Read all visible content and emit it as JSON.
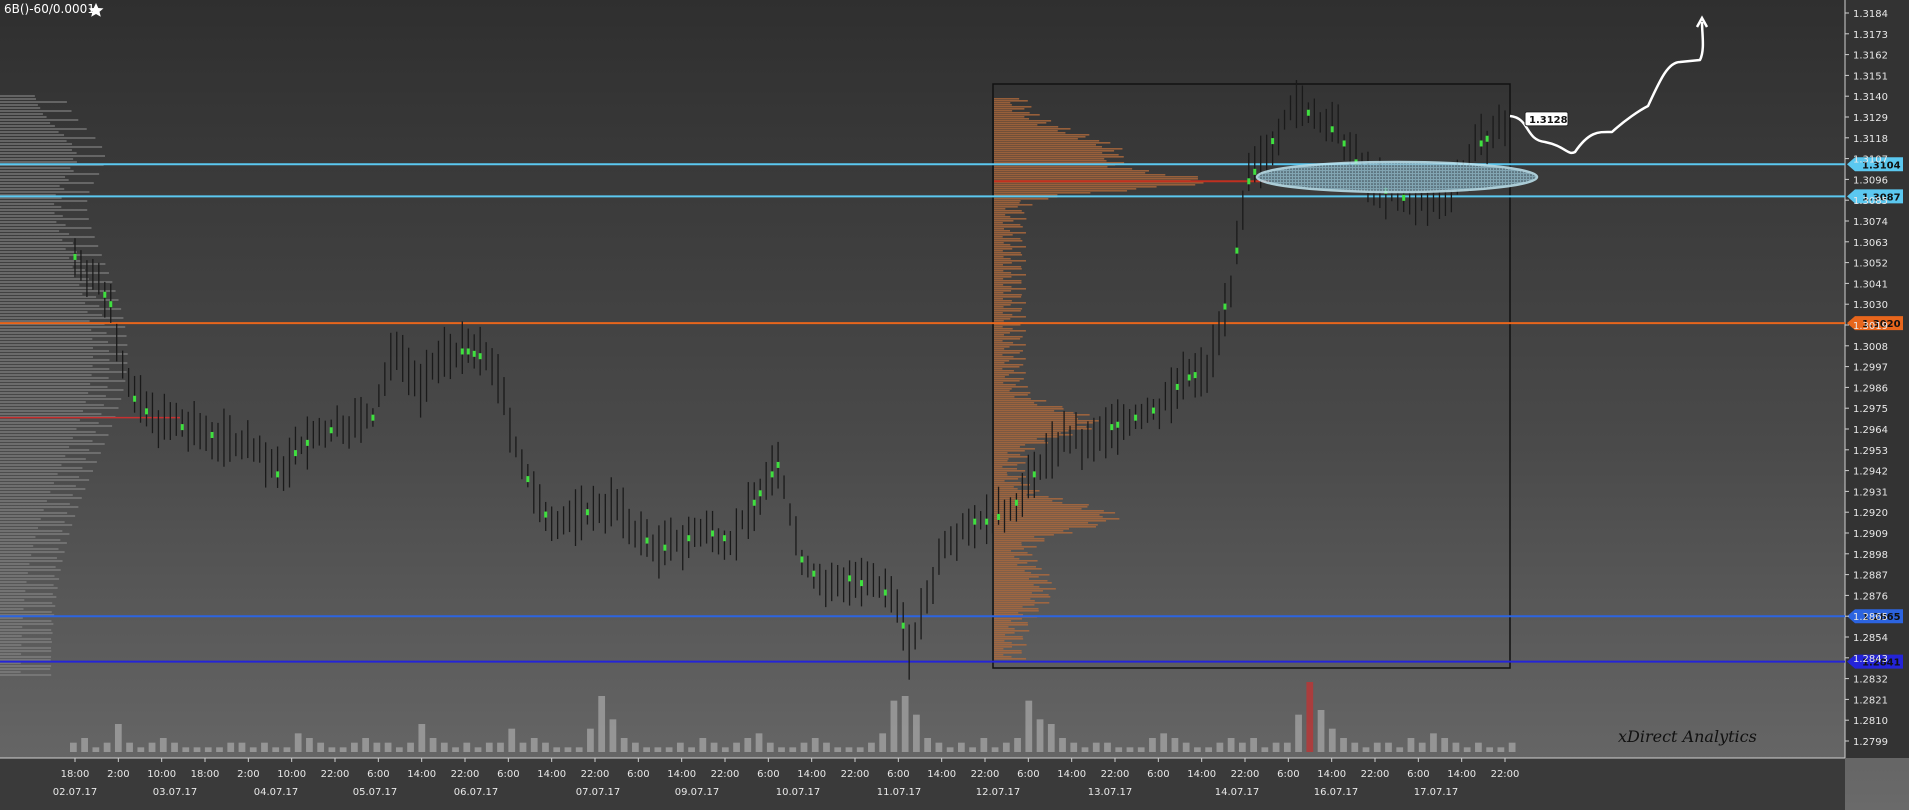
{
  "chart_data": {
    "type": "candlestick",
    "title": "6B()-60/0.0001",
    "watermark": "xDirect Analytics",
    "y_range": [
      1.279,
      1.319
    ],
    "y_ticks": [
      "1.3184",
      "1.3173",
      "1.3162",
      "1.3151",
      "1.3140",
      "1.3129",
      "1.3118",
      "1.3107",
      "1.3096",
      "1.3085",
      "1.3074",
      "1.3063",
      "1.3052",
      "1.3041",
      "1.3030",
      "1.3019",
      "1.3008",
      "1.2997",
      "1.2986",
      "1.2975",
      "1.2964",
      "1.2953",
      "1.2942",
      "1.2931",
      "1.2920",
      "1.2909",
      "1.2898",
      "1.2887",
      "1.2876",
      "1.2865",
      "1.2854",
      "1.2843",
      "1.2832",
      "1.2821",
      "1.2810",
      "1.2799"
    ],
    "x_time_labels": [
      "18:00",
      "2:00",
      "10:00",
      "18:00",
      "2:00",
      "10:00",
      "22:00",
      "6:00",
      "14:00",
      "22:00",
      "6:00",
      "14:00",
      "22:00",
      "6:00",
      "14:00",
      "22:00",
      "6:00",
      "14:00",
      "22:00",
      "6:00",
      "14:00",
      "22:00",
      "6:00",
      "14:00",
      "22:00",
      "6:00",
      "14:00",
      "22:00",
      "6:00",
      "14:00",
      "22:00",
      "6:00",
      "14:00",
      "22:00"
    ],
    "x_date_labels": [
      "02.07.17",
      "03.07.17",
      "04.07.17",
      "05.07.17",
      "06.07.17",
      "07.07.17",
      "09.07.17",
      "10.07.17",
      "11.07.17",
      "12.07.17",
      "13.07.17",
      "14.07.17",
      "16.07.17",
      "17.07.17"
    ],
    "levels": [
      {
        "price": 1.3104,
        "label": "1.3104",
        "color": "#5bc8f0"
      },
      {
        "price": 1.3087,
        "label": "1.3087",
        "color": "#5bc8f0"
      },
      {
        "price": 1.302,
        "label": "1.3020",
        "color": "#e8661c"
      },
      {
        "price": 1.2865,
        "label": "1.2865",
        "color": "#2c64e0"
      },
      {
        "price": 1.2841,
        "label": "1.2841",
        "color": "#2424d8"
      }
    ],
    "price_callout": {
      "price": 1.3128,
      "label": "1.3128"
    },
    "price_path": [
      [
        0,
        1.3055
      ],
      [
        3,
        1.3045
      ],
      [
        6,
        1.303
      ],
      [
        8,
        1.3
      ],
      [
        10,
        1.298
      ],
      [
        13,
        1.297
      ],
      [
        18,
        1.2965
      ],
      [
        24,
        1.296
      ],
      [
        30,
        1.2955
      ],
      [
        34,
        1.294
      ],
      [
        38,
        1.2955
      ],
      [
        44,
        1.2965
      ],
      [
        50,
        1.297
      ],
      [
        54,
        1.301
      ],
      [
        58,
        1.2985
      ],
      [
        62,
        1.3005
      ],
      [
        66,
        1.3005
      ],
      [
        70,
        1.3
      ],
      [
        74,
        1.2955
      ],
      [
        78,
        1.292
      ],
      [
        82,
        1.2915
      ],
      [
        86,
        1.292
      ],
      [
        90,
        1.2925
      ],
      [
        94,
        1.291
      ],
      [
        98,
        1.29
      ],
      [
        102,
        1.2905
      ],
      [
        106,
        1.291
      ],
      [
        110,
        1.2905
      ],
      [
        114,
        1.2925
      ],
      [
        118,
        1.2945
      ],
      [
        122,
        1.2895
      ],
      [
        126,
        1.288
      ],
      [
        130,
        1.2885
      ],
      [
        134,
        1.288
      ],
      [
        138,
        1.2875
      ],
      [
        140,
        1.2845
      ],
      [
        143,
        1.2875
      ],
      [
        146,
        1.2905
      ],
      [
        150,
        1.2915
      ],
      [
        154,
        1.2915
      ],
      [
        158,
        1.2925
      ],
      [
        162,
        1.2945
      ],
      [
        166,
        1.296
      ],
      [
        170,
        1.2955
      ],
      [
        174,
        1.2965
      ],
      [
        178,
        1.297
      ],
      [
        182,
        1.2975
      ],
      [
        186,
        1.299
      ],
      [
        190,
        1.2995
      ],
      [
        194,
        1.304
      ],
      [
        197,
        1.3095
      ],
      [
        200,
        1.311
      ],
      [
        204,
        1.3135
      ],
      [
        208,
        1.313
      ],
      [
        212,
        1.312
      ],
      [
        216,
        1.31
      ],
      [
        220,
        1.309
      ],
      [
        224,
        1.3085
      ],
      [
        228,
        1.3085
      ],
      [
        232,
        1.3095
      ],
      [
        236,
        1.3115
      ],
      [
        240,
        1.3125
      ]
    ],
    "volume": [
      2,
      3,
      1,
      2,
      6,
      2,
      1,
      2,
      3,
      2,
      1,
      1,
      1,
      1,
      2,
      2,
      1,
      2,
      1,
      1,
      4,
      3,
      2,
      1,
      1,
      2,
      3,
      2,
      2,
      1,
      2,
      6,
      3,
      2,
      1,
      2,
      1,
      2,
      2,
      5,
      2,
      3,
      2,
      1,
      1,
      1,
      5,
      12,
      7,
      3,
      2,
      1,
      1,
      1,
      2,
      1,
      3,
      2,
      1,
      2,
      3,
      4,
      2,
      1,
      1,
      2,
      3,
      2,
      1,
      1,
      1,
      2,
      4,
      11,
      12,
      8,
      3,
      2,
      1,
      2,
      1,
      3,
      1,
      2,
      3,
      11,
      7,
      6,
      3,
      2,
      1,
      2,
      2,
      1,
      1,
      1,
      3,
      4,
      3,
      2,
      1,
      1,
      2,
      3,
      2,
      3,
      1,
      2,
      2,
      8,
      15,
      9,
      5,
      3,
      2,
      1,
      2,
      2,
      1,
      3,
      2,
      4,
      3,
      2,
      1,
      2,
      1,
      1,
      2
    ]
  }
}
